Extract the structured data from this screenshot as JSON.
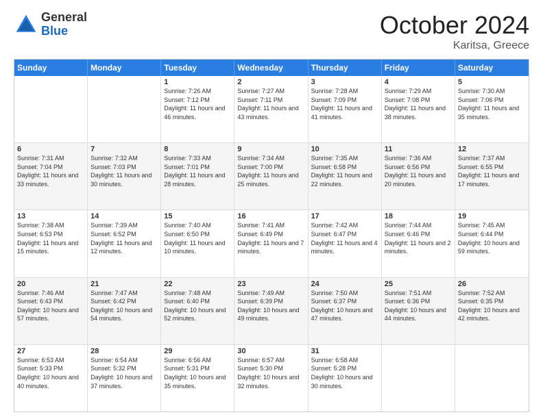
{
  "logo": {
    "general": "General",
    "blue": "Blue"
  },
  "header": {
    "month": "October 2024",
    "location": "Karitsa, Greece"
  },
  "weekdays": [
    "Sunday",
    "Monday",
    "Tuesday",
    "Wednesday",
    "Thursday",
    "Friday",
    "Saturday"
  ],
  "rows": [
    {
      "alt": false,
      "cells": [
        {
          "day": "",
          "lines": []
        },
        {
          "day": "",
          "lines": []
        },
        {
          "day": "1",
          "lines": [
            "Sunrise: 7:26 AM",
            "Sunset: 7:12 PM",
            "Daylight: 11 hours and 46 minutes."
          ]
        },
        {
          "day": "2",
          "lines": [
            "Sunrise: 7:27 AM",
            "Sunset: 7:11 PM",
            "Daylight: 11 hours and 43 minutes."
          ]
        },
        {
          "day": "3",
          "lines": [
            "Sunrise: 7:28 AM",
            "Sunset: 7:09 PM",
            "Daylight: 11 hours and 41 minutes."
          ]
        },
        {
          "day": "4",
          "lines": [
            "Sunrise: 7:29 AM",
            "Sunset: 7:08 PM",
            "Daylight: 11 hours and 38 minutes."
          ]
        },
        {
          "day": "5",
          "lines": [
            "Sunrise: 7:30 AM",
            "Sunset: 7:06 PM",
            "Daylight: 11 hours and 35 minutes."
          ]
        }
      ]
    },
    {
      "alt": true,
      "cells": [
        {
          "day": "6",
          "lines": [
            "Sunrise: 7:31 AM",
            "Sunset: 7:04 PM",
            "Daylight: 11 hours and 33 minutes."
          ]
        },
        {
          "day": "7",
          "lines": [
            "Sunrise: 7:32 AM",
            "Sunset: 7:03 PM",
            "Daylight: 11 hours and 30 minutes."
          ]
        },
        {
          "day": "8",
          "lines": [
            "Sunrise: 7:33 AM",
            "Sunset: 7:01 PM",
            "Daylight: 11 hours and 28 minutes."
          ]
        },
        {
          "day": "9",
          "lines": [
            "Sunrise: 7:34 AM",
            "Sunset: 7:00 PM",
            "Daylight: 11 hours and 25 minutes."
          ]
        },
        {
          "day": "10",
          "lines": [
            "Sunrise: 7:35 AM",
            "Sunset: 6:58 PM",
            "Daylight: 11 hours and 22 minutes."
          ]
        },
        {
          "day": "11",
          "lines": [
            "Sunrise: 7:36 AM",
            "Sunset: 6:56 PM",
            "Daylight: 11 hours and 20 minutes."
          ]
        },
        {
          "day": "12",
          "lines": [
            "Sunrise: 7:37 AM",
            "Sunset: 6:55 PM",
            "Daylight: 11 hours and 17 minutes."
          ]
        }
      ]
    },
    {
      "alt": false,
      "cells": [
        {
          "day": "13",
          "lines": [
            "Sunrise: 7:38 AM",
            "Sunset: 6:53 PM",
            "Daylight: 11 hours and 15 minutes."
          ]
        },
        {
          "day": "14",
          "lines": [
            "Sunrise: 7:39 AM",
            "Sunset: 6:52 PM",
            "Daylight: 11 hours and 12 minutes."
          ]
        },
        {
          "day": "15",
          "lines": [
            "Sunrise: 7:40 AM",
            "Sunset: 6:50 PM",
            "Daylight: 11 hours and 10 minutes."
          ]
        },
        {
          "day": "16",
          "lines": [
            "Sunrise: 7:41 AM",
            "Sunset: 6:49 PM",
            "Daylight: 11 hours and 7 minutes."
          ]
        },
        {
          "day": "17",
          "lines": [
            "Sunrise: 7:42 AM",
            "Sunset: 6:47 PM",
            "Daylight: 11 hours and 4 minutes."
          ]
        },
        {
          "day": "18",
          "lines": [
            "Sunrise: 7:44 AM",
            "Sunset: 6:46 PM",
            "Daylight: 11 hours and 2 minutes."
          ]
        },
        {
          "day": "19",
          "lines": [
            "Sunrise: 7:45 AM",
            "Sunset: 6:44 PM",
            "Daylight: 10 hours and 59 minutes."
          ]
        }
      ]
    },
    {
      "alt": true,
      "cells": [
        {
          "day": "20",
          "lines": [
            "Sunrise: 7:46 AM",
            "Sunset: 6:43 PM",
            "Daylight: 10 hours and 57 minutes."
          ]
        },
        {
          "day": "21",
          "lines": [
            "Sunrise: 7:47 AM",
            "Sunset: 6:42 PM",
            "Daylight: 10 hours and 54 minutes."
          ]
        },
        {
          "day": "22",
          "lines": [
            "Sunrise: 7:48 AM",
            "Sunset: 6:40 PM",
            "Daylight: 10 hours and 52 minutes."
          ]
        },
        {
          "day": "23",
          "lines": [
            "Sunrise: 7:49 AM",
            "Sunset: 6:39 PM",
            "Daylight: 10 hours and 49 minutes."
          ]
        },
        {
          "day": "24",
          "lines": [
            "Sunrise: 7:50 AM",
            "Sunset: 6:37 PM",
            "Daylight: 10 hours and 47 minutes."
          ]
        },
        {
          "day": "25",
          "lines": [
            "Sunrise: 7:51 AM",
            "Sunset: 6:36 PM",
            "Daylight: 10 hours and 44 minutes."
          ]
        },
        {
          "day": "26",
          "lines": [
            "Sunrise: 7:52 AM",
            "Sunset: 6:35 PM",
            "Daylight: 10 hours and 42 minutes."
          ]
        }
      ]
    },
    {
      "alt": false,
      "cells": [
        {
          "day": "27",
          "lines": [
            "Sunrise: 6:53 AM",
            "Sunset: 5:33 PM",
            "Daylight: 10 hours and 40 minutes."
          ]
        },
        {
          "day": "28",
          "lines": [
            "Sunrise: 6:54 AM",
            "Sunset: 5:32 PM",
            "Daylight: 10 hours and 37 minutes."
          ]
        },
        {
          "day": "29",
          "lines": [
            "Sunrise: 6:56 AM",
            "Sunset: 5:31 PM",
            "Daylight: 10 hours and 35 minutes."
          ]
        },
        {
          "day": "30",
          "lines": [
            "Sunrise: 6:57 AM",
            "Sunset: 5:30 PM",
            "Daylight: 10 hours and 32 minutes."
          ]
        },
        {
          "day": "31",
          "lines": [
            "Sunrise: 6:58 AM",
            "Sunset: 5:28 PM",
            "Daylight: 10 hours and 30 minutes."
          ]
        },
        {
          "day": "",
          "lines": []
        },
        {
          "day": "",
          "lines": []
        }
      ]
    }
  ]
}
